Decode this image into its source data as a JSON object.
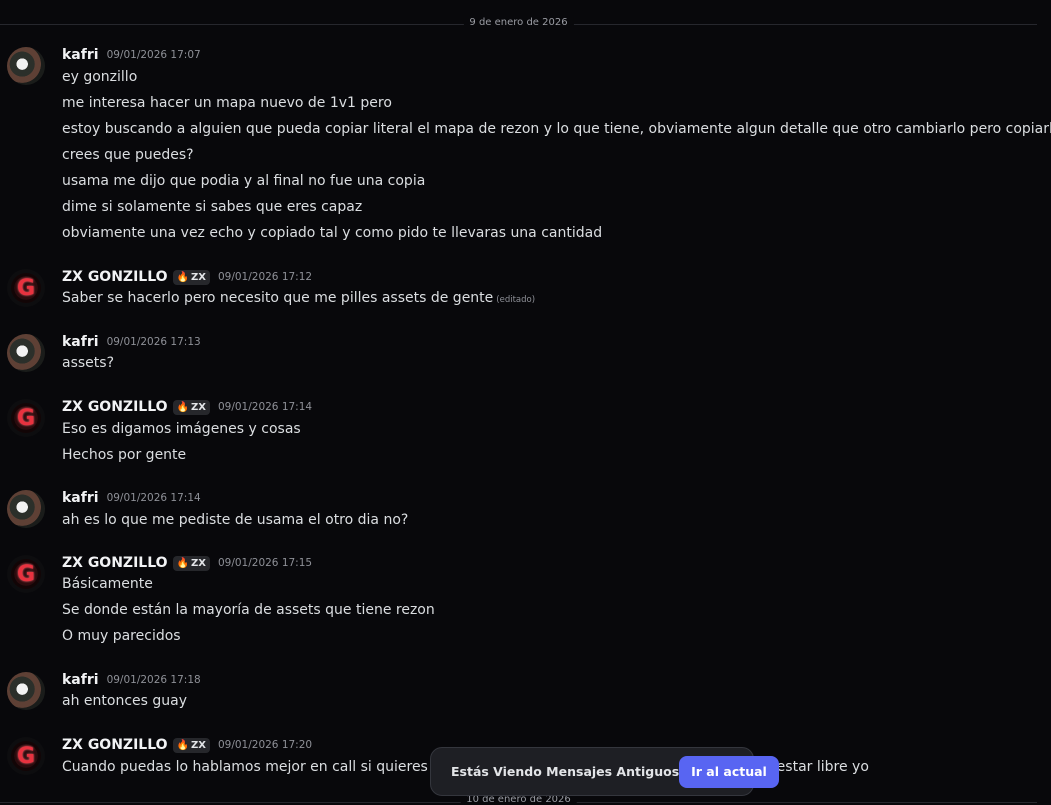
{
  "dividers": {
    "top": "9 de enero de 2026",
    "bottom": "10 de enero de 2026"
  },
  "messages": [
    {
      "author": "kafri",
      "avatar": "kafri-avatar",
      "tag": null,
      "timestamp": "09/01/2026 17:07",
      "lines": [
        "ey gonzillo",
        "me interesa hacer un mapa nuevo de 1v1 pero",
        "estoy buscando a alguien que pueda copiar literal el mapa de rezon y lo que tiene, obviamente algun detalle que otro cambiarlo pero copiarlo",
        "crees que puedes?",
        "usama me dijo que podia y al final no fue una copia",
        "dime si solamente si sabes que eres capaz",
        "obviamente una vez echo y copiado tal y como pido te llevaras una cantidad"
      ]
    },
    {
      "author": "ZX GONZILLO",
      "avatar": "gonzillo-avatar",
      "tag": "ZX",
      "timestamp": "09/01/2026 17:12",
      "lines": [
        "Saber se hacerlo pero necesito que me pilles  assets de gente"
      ],
      "edited": "(editado)"
    },
    {
      "author": "kafri",
      "avatar": "kafri-avatar",
      "tag": null,
      "timestamp": "09/01/2026 17:13",
      "lines": [
        "assets?"
      ]
    },
    {
      "author": "ZX GONZILLO",
      "avatar": "gonzillo-avatar",
      "tag": "ZX",
      "timestamp": "09/01/2026 17:14",
      "lines": [
        "Eso es digamos imágenes y cosas",
        "Hechos por gente"
      ]
    },
    {
      "author": "kafri",
      "avatar": "kafri-avatar",
      "tag": null,
      "timestamp": "09/01/2026 17:14",
      "lines": [
        "ah es lo que me pediste de usama el otro dia no?"
      ]
    },
    {
      "author": "ZX GONZILLO",
      "avatar": "gonzillo-avatar",
      "tag": "ZX",
      "timestamp": "09/01/2026 17:15",
      "lines": [
        "Básicamente",
        "Se donde están la mayoría de assets que tiene rezon",
        "O muy parecidos"
      ]
    },
    {
      "author": "kafri",
      "avatar": "kafri-avatar",
      "tag": null,
      "timestamp": "09/01/2026 17:18",
      "lines": [
        "ah entonces guay"
      ]
    },
    {
      "author": "ZX GONZILLO",
      "avatar": "gonzillo-avatar",
      "tag": "ZX",
      "timestamp": "09/01/2026 17:20",
      "lines": [
        "Cuando puedas lo hablamos mejor en call si quieres , a",
        "ría estar libre yo"
      ]
    }
  ],
  "toast": {
    "text": "Estás Viendo Mensajes Antiguos",
    "button": "Ir al actual"
  },
  "colors": {
    "background": "#08080b",
    "accent": "#5865f2",
    "gonzillo_logo": "#e8323f"
  }
}
